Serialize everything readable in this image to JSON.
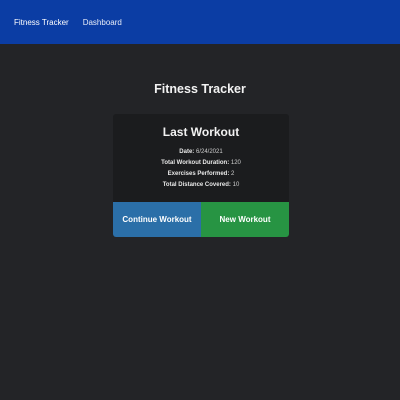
{
  "nav": {
    "brand": "Fitness Tracker",
    "links": [
      "Dashboard"
    ]
  },
  "page": {
    "title": "Fitness Tracker"
  },
  "last_workout": {
    "title": "Last Workout",
    "stats": [
      {
        "label": "Date:",
        "value": "6/24/2021"
      },
      {
        "label": "Total Workout Duration:",
        "value": "120"
      },
      {
        "label": "Exercises Performed:",
        "value": "2"
      },
      {
        "label": "Total Distance Covered:",
        "value": "10"
      }
    ]
  },
  "buttons": {
    "continue": "Continue Workout",
    "new": "New Workout"
  },
  "colors": {
    "navbar": "#0b3da4",
    "background": "#232427",
    "card": "#1b1c1e",
    "continue_button": "#2b6fa8",
    "new_button": "#279443"
  }
}
